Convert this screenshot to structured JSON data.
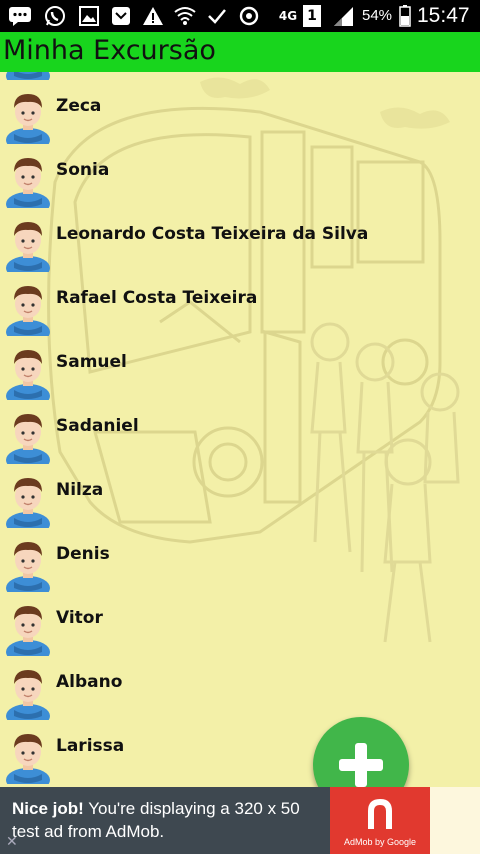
{
  "status_bar": {
    "battery_percent": "54%",
    "time": "15:47",
    "network": "4G",
    "sim_slot": "1"
  },
  "app_bar": {
    "title": "Minha Excursão"
  },
  "passengers": [
    "Zeca",
    "Sonia",
    "Leonardo Costa Teixeira da Silva",
    "Rafael Costa Teixeira",
    "Samuel",
    "Sadaniel",
    "Nilza",
    "Denis",
    "Vitor",
    "Albano",
    "Larissa"
  ],
  "fab": {
    "icon": "plus-icon"
  },
  "ad": {
    "bold": "Nice job!",
    "text": " You're displaying a 320 x 50 test ad from AdMob.",
    "brand": "AdMob by Google",
    "close": "✕"
  },
  "colors": {
    "app_bar": "#18d51d",
    "background": "#f3f0a8",
    "fab": "#41b64a",
    "ad_background": "#3e4850",
    "ad_logo": "#e1392f"
  }
}
